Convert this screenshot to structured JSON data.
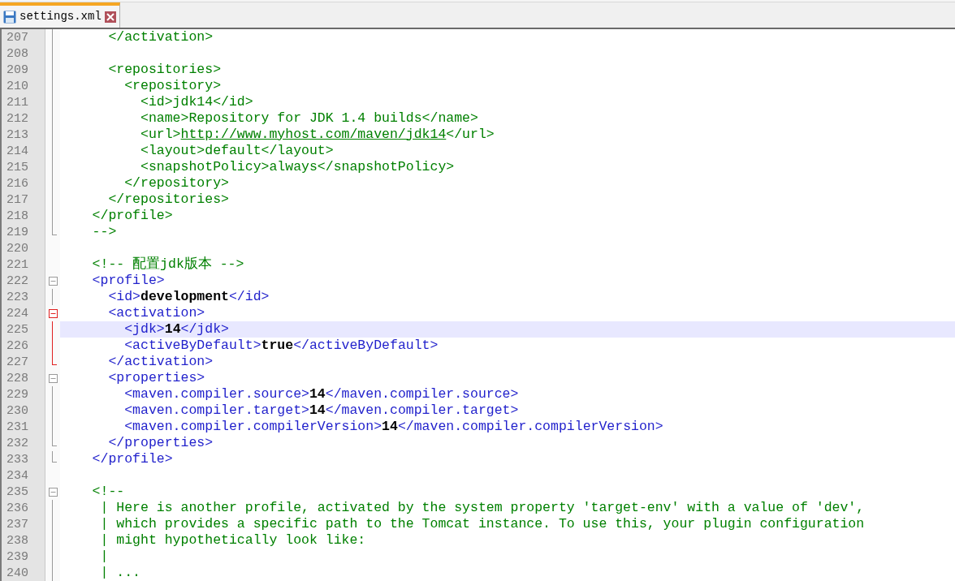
{
  "tabs": [
    {
      "label": "settings.xml",
      "selected": true
    }
  ],
  "lines": [
    {
      "number": "207",
      "in_fold": true,
      "active": false,
      "tokens": [
        {
          "kind": "comment",
          "text": "      </activation>"
        }
      ]
    },
    {
      "number": "208",
      "in_fold": true,
      "active": false
    },
    {
      "number": "209",
      "in_fold": true,
      "active": false,
      "tokens": [
        {
          "kind": "comment",
          "text": "      <repositories>"
        }
      ]
    },
    {
      "number": "210",
      "in_fold": true,
      "active": false,
      "tokens": [
        {
          "kind": "comment",
          "text": "        <repository>"
        }
      ]
    },
    {
      "number": "211",
      "in_fold": true,
      "active": false,
      "tokens": [
        {
          "kind": "comment",
          "text": "          <id>jdk14</id>"
        }
      ]
    },
    {
      "number": "212",
      "in_fold": true,
      "active": false,
      "tokens": [
        {
          "kind": "comment",
          "text": "          <name>Repository for JDK 1.4 builds</name>"
        }
      ]
    },
    {
      "number": "213",
      "in_fold": true,
      "active": false,
      "tokens": [
        {
          "kind": "comment",
          "text": "          <url>"
        },
        {
          "kind": "link",
          "text": "http://www.myhost.com/maven/jdk14"
        },
        {
          "kind": "comment",
          "text": "</url>"
        }
      ]
    },
    {
      "number": "214",
      "in_fold": true,
      "active": false,
      "tokens": [
        {
          "kind": "comment",
          "text": "          <layout>default</layout>"
        }
      ]
    },
    {
      "number": "215",
      "in_fold": true,
      "active": false,
      "tokens": [
        {
          "kind": "comment",
          "text": "          <snapshotPolicy>always</snapshotPolicy>"
        }
      ]
    },
    {
      "number": "216",
      "in_fold": true,
      "active": false,
      "tokens": [
        {
          "kind": "comment",
          "text": "        </repository>"
        }
      ]
    },
    {
      "number": "217",
      "in_fold": true,
      "active": false,
      "tokens": [
        {
          "kind": "comment",
          "text": "      </repositories>"
        }
      ]
    },
    {
      "number": "218",
      "in_fold": true,
      "active": false,
      "tokens": [
        {
          "kind": "comment",
          "text": "    </profile>"
        }
      ]
    },
    {
      "number": "219",
      "fold_end": true,
      "active": false,
      "tokens": [
        {
          "kind": "comment",
          "text": "    -->"
        }
      ]
    },
    {
      "number": "220"
    },
    {
      "number": "221",
      "tokens": [
        {
          "kind": "comment",
          "text": "    <!-- 配置jdk版本 -->"
        }
      ]
    },
    {
      "number": "222",
      "fold_start": true,
      "active": false,
      "tokens": [
        {
          "kind": "tag",
          "text": "    <profile>"
        }
      ]
    },
    {
      "number": "223",
      "in_fold": true,
      "active": false,
      "tokens": [
        {
          "kind": "tag",
          "text": "      <id>"
        },
        {
          "kind": "value",
          "text": "development"
        },
        {
          "kind": "tag",
          "text": "</id>"
        }
      ]
    },
    {
      "number": "224",
      "fold_start": true,
      "active": true,
      "tokens": [
        {
          "kind": "tag",
          "text": "      <activation>"
        }
      ]
    },
    {
      "number": "225",
      "in_fold": true,
      "active": true,
      "current": true,
      "tokens": [
        {
          "kind": "tag",
          "text": "        <jdk>"
        },
        {
          "kind": "value",
          "text": "14"
        },
        {
          "kind": "tag",
          "text": "</jdk>"
        }
      ]
    },
    {
      "number": "226",
      "in_fold": true,
      "active": true,
      "tokens": [
        {
          "kind": "tag",
          "text": "        <activeByDefault>"
        },
        {
          "kind": "value",
          "text": "true"
        },
        {
          "kind": "tag",
          "text": "</activeByDefault>"
        }
      ]
    },
    {
      "number": "227",
      "fold_end": true,
      "active": true,
      "tokens": [
        {
          "kind": "tag",
          "text": "      </activation>"
        }
      ]
    },
    {
      "number": "228",
      "fold_start": true,
      "active": false,
      "tokens": [
        {
          "kind": "tag",
          "text": "      <properties>"
        }
      ]
    },
    {
      "number": "229",
      "in_fold": true,
      "active": false,
      "tokens": [
        {
          "kind": "tag",
          "text": "        <maven.compiler.source>"
        },
        {
          "kind": "value",
          "text": "14"
        },
        {
          "kind": "tag",
          "text": "</maven.compiler.source>"
        }
      ]
    },
    {
      "number": "230",
      "in_fold": true,
      "active": false,
      "tokens": [
        {
          "kind": "tag",
          "text": "        <maven.compiler.target>"
        },
        {
          "kind": "value",
          "text": "14"
        },
        {
          "kind": "tag",
          "text": "</maven.compiler.target>"
        }
      ]
    },
    {
      "number": "231",
      "in_fold": true,
      "active": false,
      "tokens": [
        {
          "kind": "tag",
          "text": "        <maven.compiler.compilerVersion>"
        },
        {
          "kind": "value",
          "text": "14"
        },
        {
          "kind": "tag",
          "text": "</maven.compiler.compilerVersion>"
        }
      ]
    },
    {
      "number": "232",
      "fold_end": true,
      "active": false,
      "tokens": [
        {
          "kind": "tag",
          "text": "      </properties>"
        }
      ]
    },
    {
      "number": "233",
      "fold_end": true,
      "active": false,
      "tokens": [
        {
          "kind": "tag",
          "text": "    </profile>"
        }
      ]
    },
    {
      "number": "234"
    },
    {
      "number": "235",
      "fold_start": true,
      "active": false,
      "tokens": [
        {
          "kind": "comment",
          "text": "    <!--"
        }
      ]
    },
    {
      "number": "236",
      "in_fold": true,
      "active": false,
      "tokens": [
        {
          "kind": "comment",
          "text": "     | Here is another profile, activated by the system property 'target-env' with a value of 'dev',"
        }
      ]
    },
    {
      "number": "237",
      "in_fold": true,
      "active": false,
      "tokens": [
        {
          "kind": "comment",
          "text": "     | which provides a specific path to the Tomcat instance. To use this, your plugin configuration"
        }
      ]
    },
    {
      "number": "238",
      "in_fold": true,
      "active": false,
      "tokens": [
        {
          "kind": "comment",
          "text": "     | might hypothetically look like:"
        }
      ]
    },
    {
      "number": "239",
      "in_fold": true,
      "active": false,
      "tokens": [
        {
          "kind": "comment",
          "text": "     |"
        }
      ]
    },
    {
      "number": "240",
      "in_fold": true,
      "active": false,
      "tokens": [
        {
          "kind": "comment",
          "text": "     | ..."
        }
      ]
    }
  ]
}
